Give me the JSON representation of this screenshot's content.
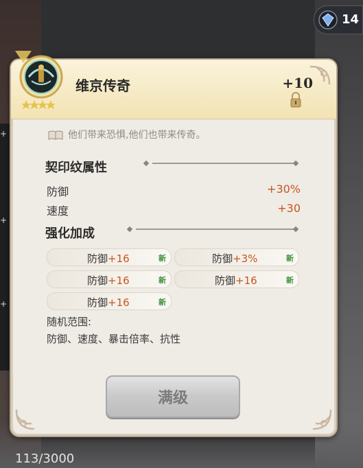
{
  "hud": {
    "gem_count": "14",
    "bottom_count": "113/3000"
  },
  "item": {
    "name": "维京传奇",
    "level": "+10"
  },
  "flavor": "他们带来恐惧,他们也带来传奇。",
  "seal_stats": {
    "title": "契印纹属性",
    "rows": [
      {
        "label": "防御",
        "value": "+30%"
      },
      {
        "label": "速度",
        "value": "+30"
      }
    ]
  },
  "enhance": {
    "title": "强化加成",
    "bonuses": [
      {
        "name": "防御",
        "value": "+16",
        "tag": "新"
      },
      {
        "name": "防御",
        "value": "+3%",
        "tag": "新"
      },
      {
        "name": "防御",
        "value": "+16",
        "tag": "新"
      },
      {
        "name": "防御",
        "value": "+16",
        "tag": "新"
      },
      {
        "name": "防御",
        "value": "+16",
        "tag": "新"
      }
    ]
  },
  "random_range": {
    "title": "随机范围:",
    "list": "防御、速度、暴击倍率、抗性"
  },
  "buttons": {
    "max_level": "满级"
  },
  "colors": {
    "accent_value": "#c8551c",
    "new_tag": "#3f8f3a",
    "header_gold": "#f3e3b3"
  },
  "icons": [
    "gem-icon",
    "lock-icon",
    "book-icon",
    "viking-emblem-icon",
    "star-icon"
  ]
}
